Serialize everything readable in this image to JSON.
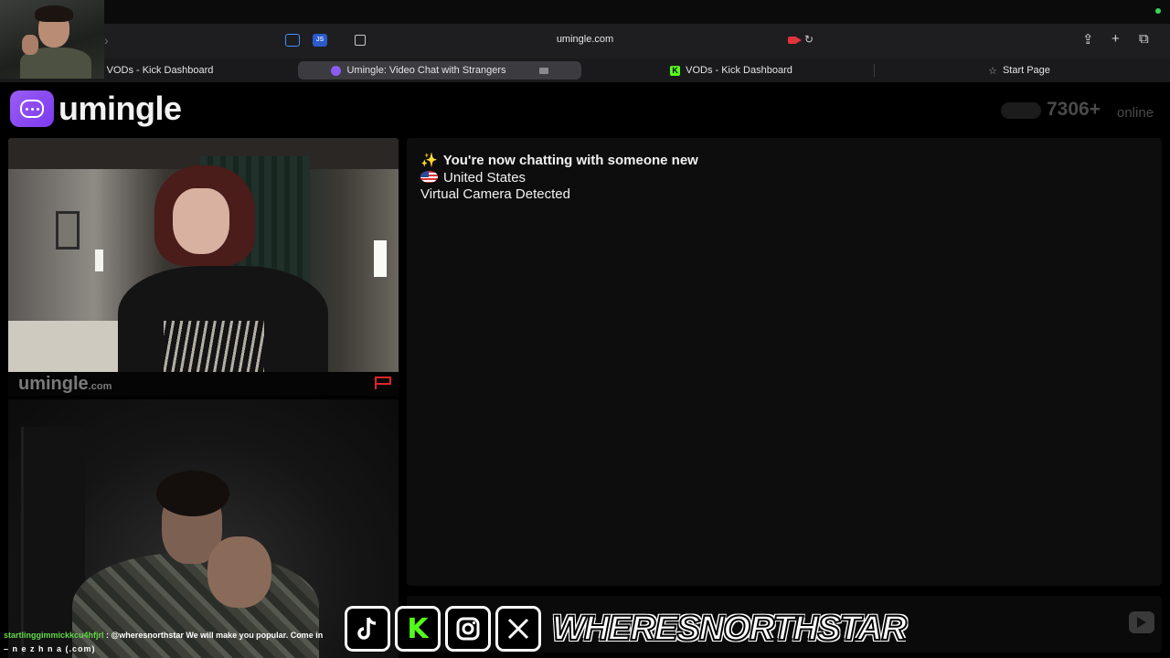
{
  "browser": {
    "url": "umingle.com",
    "tabs": [
      {
        "label": "VODs - Kick Dashboard",
        "active": false
      },
      {
        "label": "Umingle: Video Chat with Strangers",
        "active": true
      },
      {
        "label": "VODs - Kick Dashboard",
        "active": false
      },
      {
        "label": "Start Page",
        "active": false
      }
    ],
    "js_icon": "JS"
  },
  "site": {
    "logo_text": "umingle",
    "online_count": "7306+",
    "online_label": "online",
    "brand_color": "#8b5cf6"
  },
  "stranger_video": {
    "watermark": "umingle",
    "watermark_suffix": ".com"
  },
  "chat": {
    "messages": [
      {
        "icon": "sparkles-icon",
        "text": "You're now chatting with someone new"
      },
      {
        "icon": "us-flag-icon",
        "text": "United States"
      },
      {
        "icon": "",
        "text": "Virtual Camera Detected"
      }
    ]
  },
  "overlay": {
    "socials": [
      "tiktok-icon",
      "kick-icon",
      "instagram-icon",
      "x-icon"
    ],
    "handle": "WHERESNORTHSTAR",
    "ticker_user": "startlinggimmickkcu4hfjrl",
    "ticker_sep": " : ",
    "ticker_text": "@wheresnorthstar We will make you popular. Come in",
    "ticker_line2": "– n e z h n a (.com)"
  }
}
